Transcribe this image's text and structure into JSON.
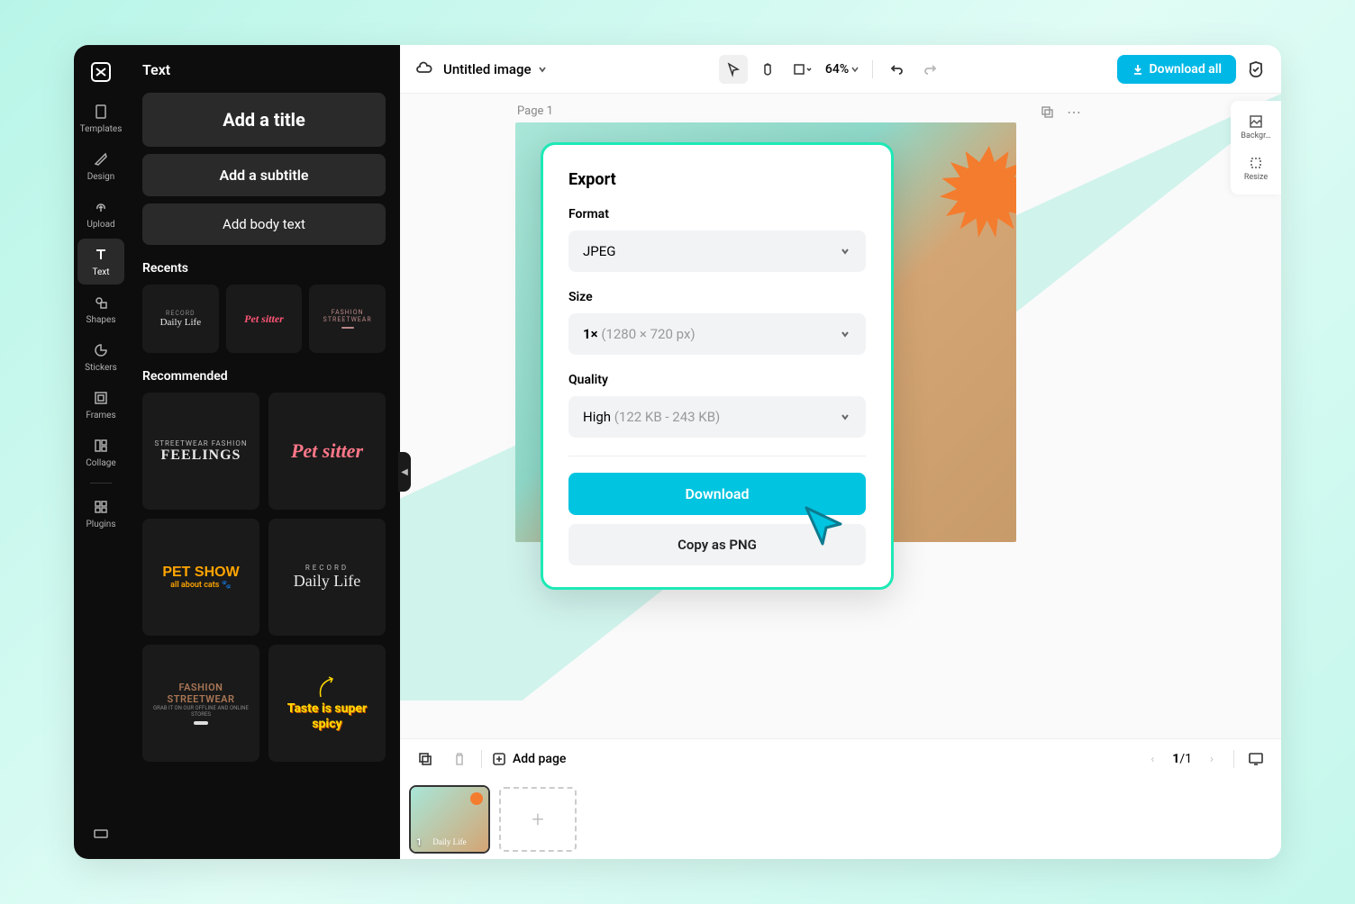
{
  "rail": {
    "items": [
      {
        "label": "Templates"
      },
      {
        "label": "Design"
      },
      {
        "label": "Upload"
      },
      {
        "label": "Text"
      },
      {
        "label": "Shapes"
      },
      {
        "label": "Stickers"
      },
      {
        "label": "Frames"
      },
      {
        "label": "Collage"
      },
      {
        "label": "Plugins"
      }
    ],
    "active_index": 3
  },
  "panel": {
    "title": "Text",
    "add_title": "Add a title",
    "add_subtitle": "Add a subtitle",
    "add_body": "Add body text",
    "recents_heading": "Recents",
    "recents": [
      {
        "top": "RECORD",
        "main": "Daily Life"
      },
      {
        "main": "Pet sitter"
      },
      {
        "top": "FASHION STREETWEAR"
      }
    ],
    "recommended_heading": "Recommended",
    "recommended": [
      {
        "top": "STREETWEAR FASHION",
        "main": "FEELINGS"
      },
      {
        "main": "Pet sitter"
      },
      {
        "main": "PET SHOW",
        "sub": "all about cats"
      },
      {
        "top": "RECORD",
        "main": "Daily Life"
      },
      {
        "main": "FASHION STREETWEAR",
        "sub": "GRAB IT ON OUR OFFLINE AND ONLINE STORES"
      },
      {
        "main": "Taste is super spicy"
      }
    ]
  },
  "toolbar": {
    "doc_title": "Untitled image",
    "zoom": "64%",
    "download_all": "Download all"
  },
  "canvas": {
    "page_label": "Page 1"
  },
  "float": {
    "background": "Backgr…",
    "resize": "Resize"
  },
  "export": {
    "title": "Export",
    "format_label": "Format",
    "format_value": "JPEG",
    "size_label": "Size",
    "size_value_prefix": "1×",
    "size_value_dims": "(1280 × 720 px)",
    "quality_label": "Quality",
    "quality_value": "High",
    "quality_range": "(122 KB - 243 KB)",
    "download": "Download",
    "copy_png": "Copy as PNG"
  },
  "bottom": {
    "add_page": "Add page",
    "page_current": "1",
    "page_total": "1",
    "page_sep": "/",
    "thumb_label": "Daily Life",
    "thumb_num": "1"
  }
}
